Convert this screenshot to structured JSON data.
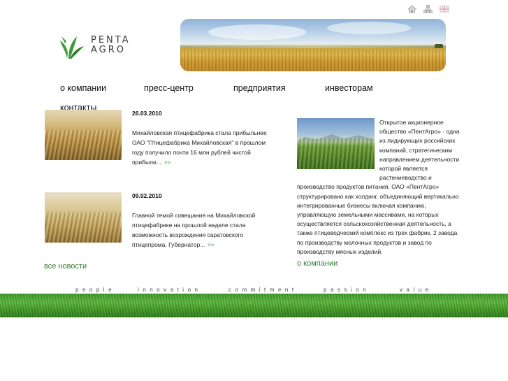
{
  "header": {
    "icons": [
      "home-icon",
      "sitemap-icon",
      "english-flag-icon"
    ],
    "logo_text_line1": "PENTA",
    "logo_text_line2": "AGRO"
  },
  "nav": {
    "items": [
      {
        "label": "о компании"
      },
      {
        "label": "пресс-центр"
      },
      {
        "label": "предприятия"
      },
      {
        "label": "инвесторам"
      },
      {
        "label": "контакты"
      }
    ]
  },
  "news": {
    "items": [
      {
        "date": "26.03.2010",
        "text": "Михайловская птицефабрика стала прибыльнее ОАО \"Птицефабрика Михайловская\" в прошлом году получило почти 16 млн рублей чистой прибыли...",
        "more": ">>"
      },
      {
        "date": "09.02.2010",
        "text": "Главной темой совещания на Михайловской птицефабрике на прошлой неделе стала возможность возрождения саратовского птицепрома. Губернатор...",
        "more": ">>"
      }
    ],
    "all_news_label": "все новости"
  },
  "about": {
    "text": "Открытое акционерное общество «ПентАгро» - одна из лидирующих российских компаний, стратегическим направлением деятельности которой является растениеводство и производство продуктов питания. ОАО «ПентАгро» структурировано как холдинг, объединяющий вертикально интегрированные бизнесы включая компанию, управляющую земельными массивами, на которых осуществляется сельскохозяйственная деятельность, а также птицеводческий комплекс из трех фабрик, 2 завода по производству молочных продуктов и завод по производству мясных изделий.",
    "link_label": "о компании"
  },
  "footer": {
    "tagline": [
      "people",
      "innovation",
      "commitment",
      "passion",
      "value"
    ]
  },
  "colors": {
    "accent_green": "#2e7f2e",
    "grass_green": "#4faa30"
  }
}
